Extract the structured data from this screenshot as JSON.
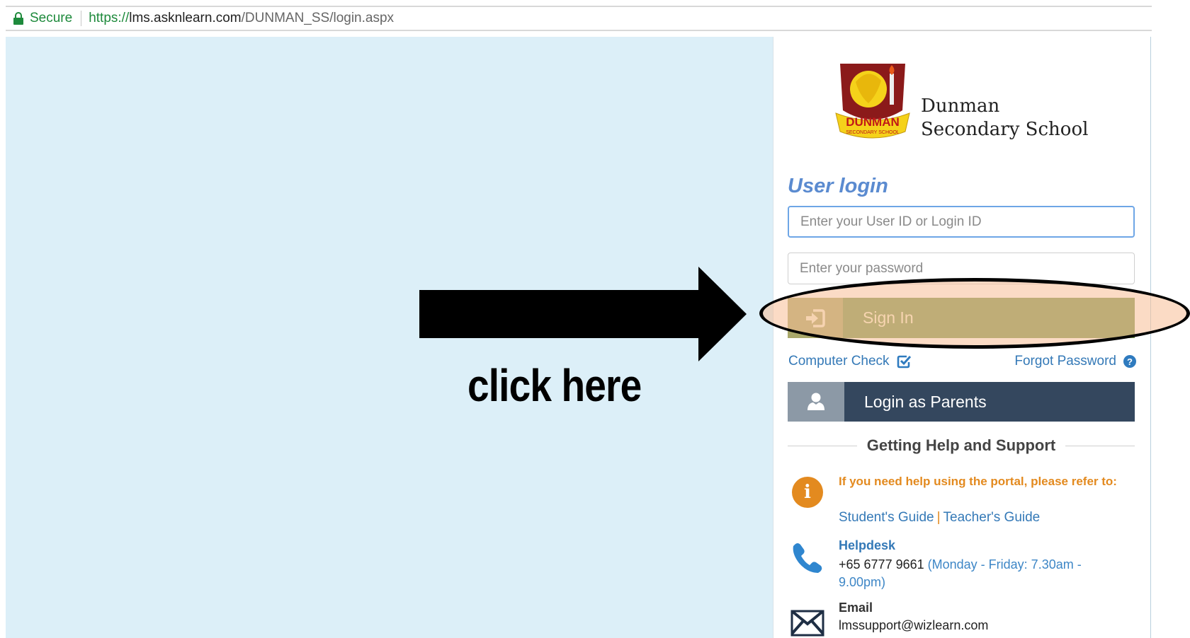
{
  "address_bar": {
    "secure_label": "Secure",
    "url_protocol": "https://",
    "url_host": "lms.asknlearn.com",
    "url_path": "/DUNMAN_SS/login.aspx"
  },
  "school": {
    "name_line1": "Dunman",
    "name_line2": "Secondary School",
    "logo_text": "DUNMAN",
    "logo_subtext": "SECONDARY SCHOOL"
  },
  "login": {
    "title": "User login",
    "userid_placeholder": "Enter your User ID or Login ID",
    "password_placeholder": "Enter your password",
    "signin_label": "Sign In",
    "computer_check_label": "Computer Check",
    "forgot_password_label": "Forgot Password",
    "parents_label": "Login as Parents"
  },
  "help": {
    "heading": "Getting Help and Support",
    "note": "If you need help using the portal, please refer to:",
    "student_guide": "Student's Guide",
    "guide_separator": "|",
    "teacher_guide": "Teacher's Guide",
    "helpdesk_title": "Helpdesk",
    "helpdesk_phone": "+65 6777 9661",
    "helpdesk_hours": "(Monday - Friday: 7.30am - 9.00pm)",
    "email_title": "Email",
    "email_address": "lmssupport@wizlearn.com"
  },
  "annotation": {
    "callout_text": "click here"
  },
  "colors": {
    "background": "#dceff8",
    "accent_blue": "#3479b7",
    "title_blue": "#5b8bd0",
    "signin_green": "#7b9a52",
    "parents_navy": "#34475e",
    "help_orange": "#e38a1f",
    "secure_green": "#1e8a3c"
  }
}
